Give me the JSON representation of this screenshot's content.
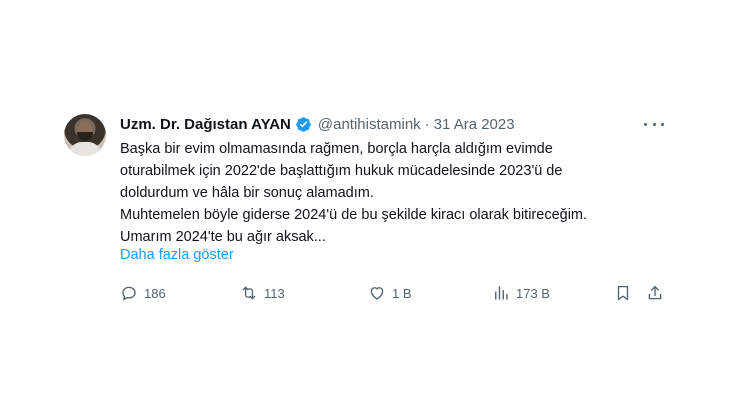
{
  "author": {
    "display_name": "Uzm. Dr. Dağıstan AYAN",
    "handle": "@antihistamink",
    "separator": "·",
    "date": "31 Ara 2023"
  },
  "tweet": {
    "lines": [
      "Başka bir evim olmamasında rağmen, borçla harçla aldığım evimde",
      "oturabilmek için 2022'de başlattığım hukuk mücadelesinde 2023'ü de",
      "doldurdum ve hâla bir sonuç alamadım.",
      "Muhtemelen böyle giderse 2024'ü de bu şekilde kiracı olarak bitireceğim.",
      "Umarım 2024'te bu ağır aksak..."
    ],
    "show_more": "Daha fazla göster"
  },
  "actions": {
    "replies": "186",
    "reposts": "113",
    "likes": "1 B",
    "views": "173 B"
  },
  "colors": {
    "accent": "#1d9bf0",
    "secondary_text": "#536471",
    "primary_text": "#0f1419"
  },
  "icons": [
    "verified-badge-icon",
    "more-icon",
    "reply-icon",
    "repost-icon",
    "like-icon",
    "views-icon",
    "bookmark-icon",
    "share-icon"
  ]
}
